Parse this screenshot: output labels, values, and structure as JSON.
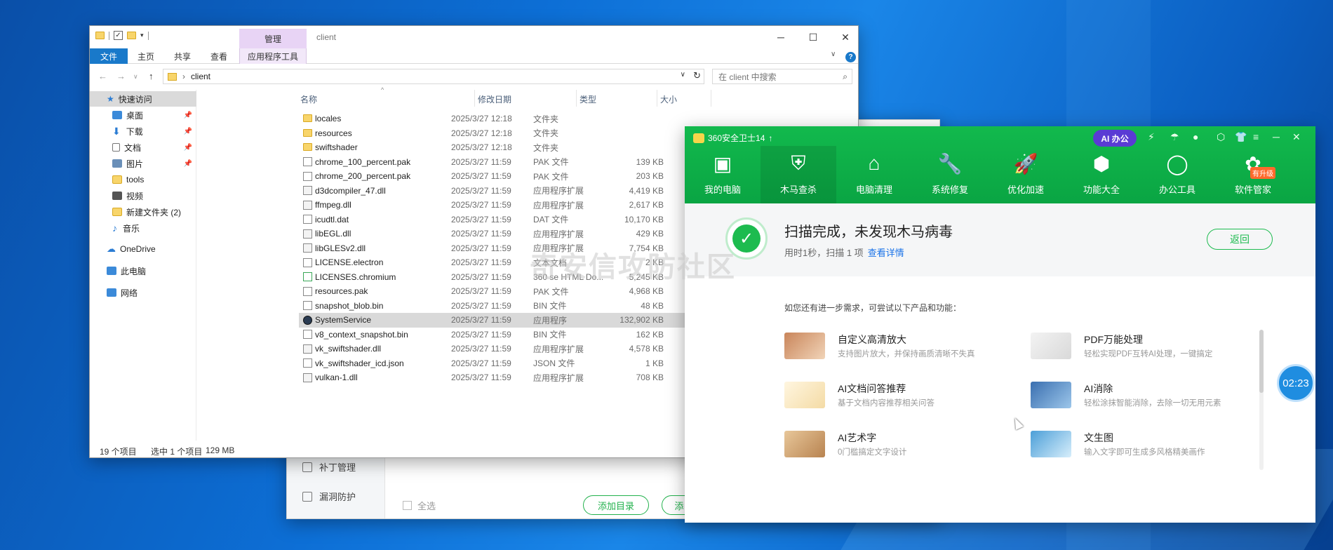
{
  "explorer": {
    "title": "client",
    "manage_tab": "管理",
    "ribbon_tabs": [
      "文件",
      "主页",
      "共享",
      "查看",
      "应用程序工具"
    ],
    "address_path": "client",
    "search_placeholder": "在 client 中搜索",
    "nav": [
      "快速访问",
      "桌面",
      "下载",
      "文档",
      "图片",
      "tools",
      "视频",
      "新建文件夹 (2)",
      "音乐",
      "OneDrive",
      "此电脑",
      "网络"
    ],
    "columns": [
      "名称",
      "修改日期",
      "类型",
      "大小"
    ],
    "files": [
      {
        "name": "locales",
        "date": "2025/3/27 12:18",
        "type": "文件夹",
        "size": "",
        "icon": "folder"
      },
      {
        "name": "resources",
        "date": "2025/3/27 12:18",
        "type": "文件夹",
        "size": "",
        "icon": "folder"
      },
      {
        "name": "swiftshader",
        "date": "2025/3/27 12:18",
        "type": "文件夹",
        "size": "",
        "icon": "folder"
      },
      {
        "name": "chrome_100_percent.pak",
        "date": "2025/3/27 11:59",
        "type": "PAK 文件",
        "size": "139 KB",
        "icon": "file"
      },
      {
        "name": "chrome_200_percent.pak",
        "date": "2025/3/27 11:59",
        "type": "PAK 文件",
        "size": "203 KB",
        "icon": "file"
      },
      {
        "name": "d3dcompiler_47.dll",
        "date": "2025/3/27 11:59",
        "type": "应用程序扩展",
        "size": "4,419 KB",
        "icon": "dll"
      },
      {
        "name": "ffmpeg.dll",
        "date": "2025/3/27 11:59",
        "type": "应用程序扩展",
        "size": "2,617 KB",
        "icon": "dll"
      },
      {
        "name": "icudtl.dat",
        "date": "2025/3/27 11:59",
        "type": "DAT 文件",
        "size": "10,170 KB",
        "icon": "file"
      },
      {
        "name": "libEGL.dll",
        "date": "2025/3/27 11:59",
        "type": "应用程序扩展",
        "size": "429 KB",
        "icon": "dll"
      },
      {
        "name": "libGLESv2.dll",
        "date": "2025/3/27 11:59",
        "type": "应用程序扩展",
        "size": "7,754 KB",
        "icon": "dll"
      },
      {
        "name": "LICENSE.electron",
        "date": "2025/3/27 11:59",
        "type": "文本文档",
        "size": "2 KB",
        "icon": "file"
      },
      {
        "name": "LICENSES.chromium",
        "date": "2025/3/27 11:59",
        "type": "360 se HTML Do...",
        "size": "5,245 KB",
        "icon": "html"
      },
      {
        "name": "resources.pak",
        "date": "2025/3/27 11:59",
        "type": "PAK 文件",
        "size": "4,968 KB",
        "icon": "file"
      },
      {
        "name": "snapshot_blob.bin",
        "date": "2025/3/27 11:59",
        "type": "BIN 文件",
        "size": "48 KB",
        "icon": "file"
      },
      {
        "name": "SystemService",
        "date": "2025/3/27 11:59",
        "type": "应用程序",
        "size": "132,902 KB",
        "icon": "exe",
        "selected": true
      },
      {
        "name": "v8_context_snapshot.bin",
        "date": "2025/3/27 11:59",
        "type": "BIN 文件",
        "size": "162 KB",
        "icon": "file"
      },
      {
        "name": "vk_swiftshader.dll",
        "date": "2025/3/27 11:59",
        "type": "应用程序扩展",
        "size": "4,578 KB",
        "icon": "dll"
      },
      {
        "name": "vk_swiftshader_icd.json",
        "date": "2025/3/27 11:59",
        "type": "JSON 文件",
        "size": "1 KB",
        "icon": "file"
      },
      {
        "name": "vulkan-1.dll",
        "date": "2025/3/27 11:59",
        "type": "应用程序扩展",
        "size": "708 KB",
        "icon": "dll"
      }
    ],
    "status": {
      "count": "19 个项目",
      "selected": "选中 1 个项目",
      "size": "129 MB"
    }
  },
  "background_window": {
    "side_items": [
      "补丁管理",
      "漏洞防护"
    ],
    "select_all": "全选",
    "add_dir_button": "添加目录",
    "other_button": "添"
  },
  "app360": {
    "brand": "360安全卫士14",
    "ai_button": "AI 办公",
    "tabs": [
      "我的电脑",
      "木马查杀",
      "电脑清理",
      "系统修复",
      "优化加速",
      "功能大全",
      "办公工具",
      "软件管家"
    ],
    "upgrade_badge": "有升级",
    "result_title": "扫描完成，未发现木马病毒",
    "result_sub": "用时1秒，扫描 1 项",
    "result_link": "查看详情",
    "back_button": "返回",
    "hint": "如您还有进一步需求，可尝试以下产品和功能：",
    "products": [
      {
        "title": "自定义高清放大",
        "desc": "支持图片放大，并保持画质清晰不失真"
      },
      {
        "title": "PDF万能处理",
        "desc": "轻松实现PDF互转AI处理，一键搞定"
      },
      {
        "title": "AI文档问答推荐",
        "desc": "基于文档内容推荐相关问答"
      },
      {
        "title": "AI消除",
        "desc": "轻松涂抹智能消除，去除一切无用元素"
      },
      {
        "title": "AI艺术字",
        "desc": "0门槛搞定文字设计"
      },
      {
        "title": "文生图",
        "desc": "输入文字即可生成多风格精美画作"
      }
    ]
  },
  "timer": "02:23",
  "watermark": "奇安信攻防社区",
  "colors": {
    "green": "#0fb34a",
    "explorer_blue": "#1979ca",
    "ai_purple": "#5a3bd4"
  }
}
